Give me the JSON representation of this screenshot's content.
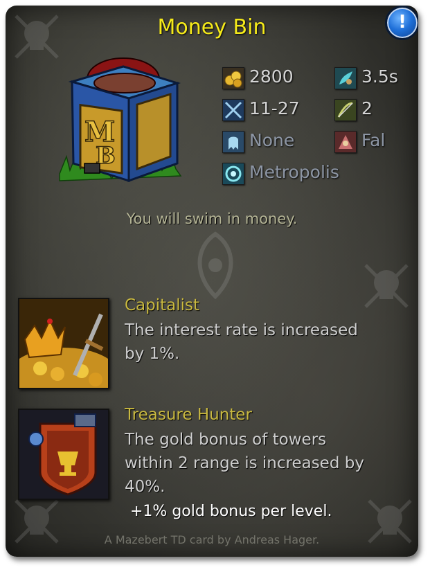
{
  "card": {
    "title": "Money Bin",
    "description": "You will swim in money.",
    "footer": "A Mazebert TD card by Andreas Hager."
  },
  "info_button": {
    "label": "!"
  },
  "stats": {
    "cost": "2800",
    "cooldown": "3.5s",
    "damage": "11-27",
    "range": "2",
    "attack_type": "None",
    "element": "Fal",
    "base": "Metropolis"
  },
  "abilities": [
    {
      "title": "Capitalist",
      "text_lines": [
        "The interest rate is increased",
        "by 1%."
      ],
      "bonus": ""
    },
    {
      "title": "Treasure Hunter",
      "text_lines": [
        "The gold bonus of towers",
        "within 2 range is increased by",
        "40%."
      ],
      "bonus": "+1% gold bonus per level."
    }
  ],
  "colors": {
    "title": "#f5ea1a",
    "ability_title": "#c9b940",
    "description": "#b5b596",
    "stat_text": "#d4d4d4",
    "stat_dim": "#8d96a5",
    "info_button": "#1e6fd8"
  },
  "icons": {
    "cost": "gold-coins-icon",
    "cooldown": "cooldown-icon",
    "damage": "crossed-swords-icon",
    "range": "bow-range-icon",
    "attack_type": "ghost-icon",
    "element": "element-icon",
    "base": "metropolis-icon"
  }
}
